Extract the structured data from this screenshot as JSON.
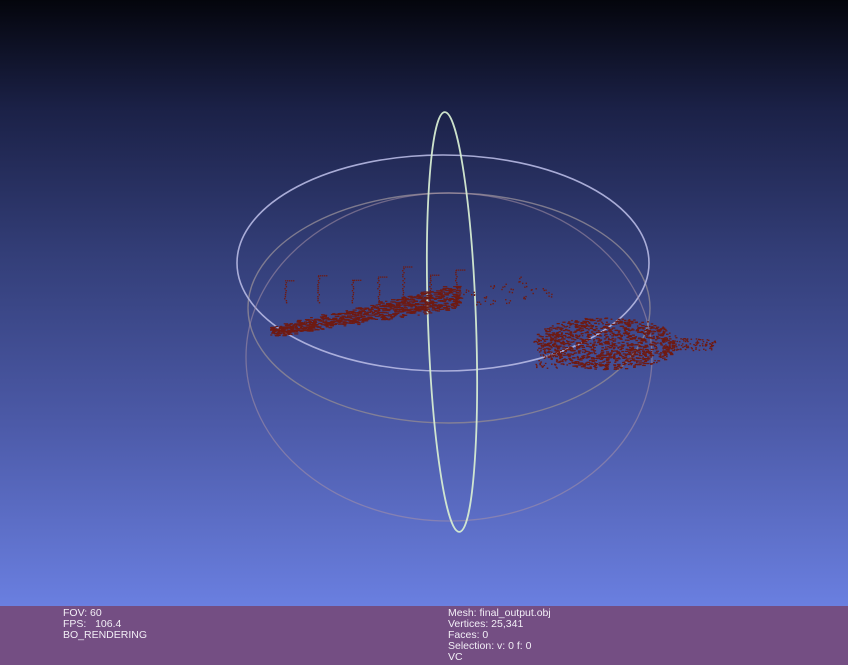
{
  "viewer": {
    "point_color": "#6e1a12",
    "background_top": "#04050c",
    "background_bottom": "#6a7fe0",
    "trackball": {
      "horizontal_ring_color": "#b7b9e3",
      "horizontal_ring_inner_color": "#9a8f9a",
      "vertical_ring_color": "#d6ecd2"
    }
  },
  "status": {
    "fov": "FOV: 60",
    "fps": "FPS:   106.4",
    "rendering": "BO_RENDERING",
    "mesh": "Mesh: final_output.obj",
    "vertices": "Vertices: 25,341",
    "faces": "Faces: 0",
    "selection": "Selection: v: 0 f: 0",
    "vc": "VC"
  },
  "colors": {
    "statusbar_bg": "#744e83",
    "statusbar_text": "#f2eef6"
  }
}
